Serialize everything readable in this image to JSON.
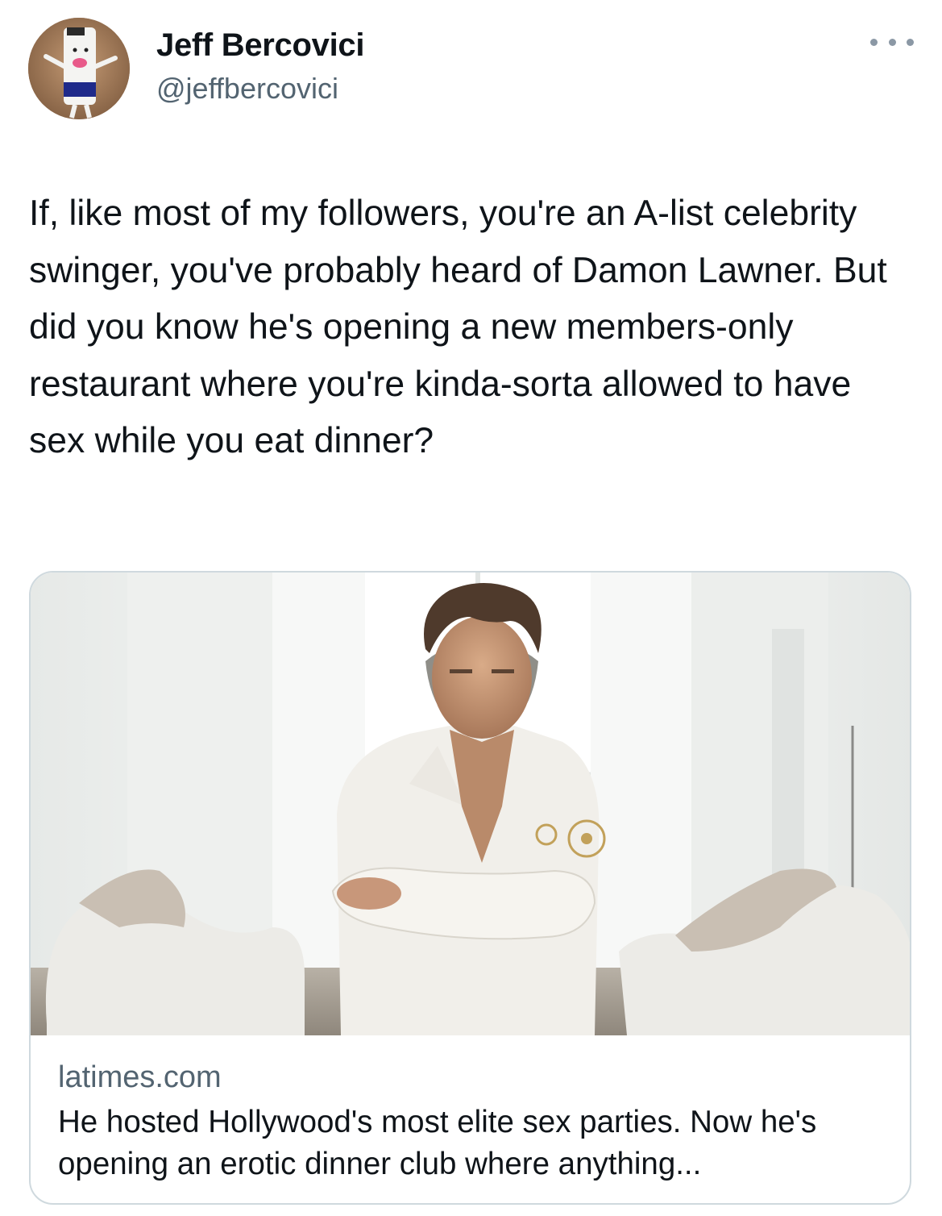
{
  "author": {
    "display_name": "Jeff Bercovici",
    "handle": "@jeffbercovici",
    "avatar_icon": "puppet-avatar"
  },
  "more_icon": "more-options-icon",
  "tweet": {
    "text": "If, like most of my followers, you're an A-list celebrity swinger, you've probably heard of Damon Lawner. But did you know he's opening a new members-only restaurant where you're kinda-sorta allowed to have sex while you eat dinner?"
  },
  "link_card": {
    "domain": "latimes.com",
    "title": "He hosted Hollywood's most elite sex parties. Now he's opening an erotic dinner club where anything..."
  },
  "colors": {
    "text": "#0f1419",
    "secondary": "#536471",
    "border": "#cfd9de"
  }
}
